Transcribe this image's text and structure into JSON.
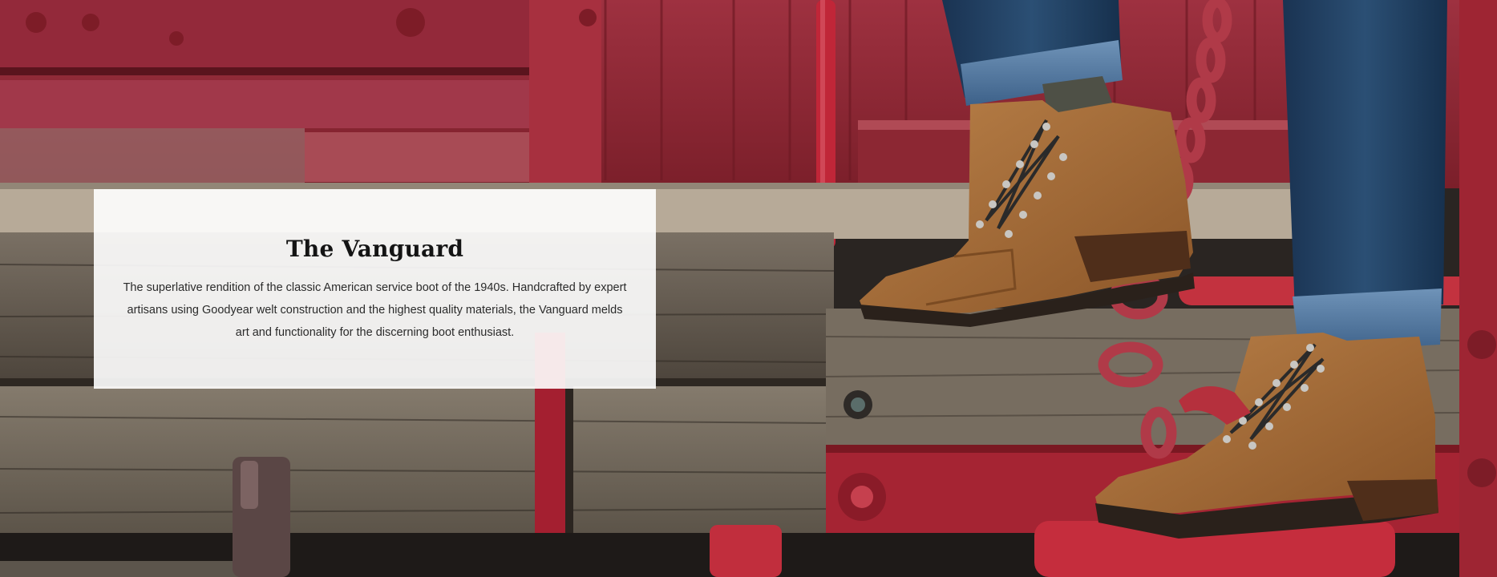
{
  "hero": {
    "image_alt": "Boots stepping onto a weathered red railcar step",
    "colors": {
      "rail_red": "#8c2a33",
      "wood_gray": "#6d6457",
      "denim": "#1f3d5d",
      "leather": "#a46a33",
      "overlay": "#ffffff"
    }
  },
  "overlay": {
    "title": "The Vanguard",
    "description": "The superlative rendition of the classic American service boot of the 1940s. Handcrafted by expert artisans using Goodyear welt construction and the highest quality materials, the Vanguard melds art and functionality for the discerning boot enthusiast."
  }
}
